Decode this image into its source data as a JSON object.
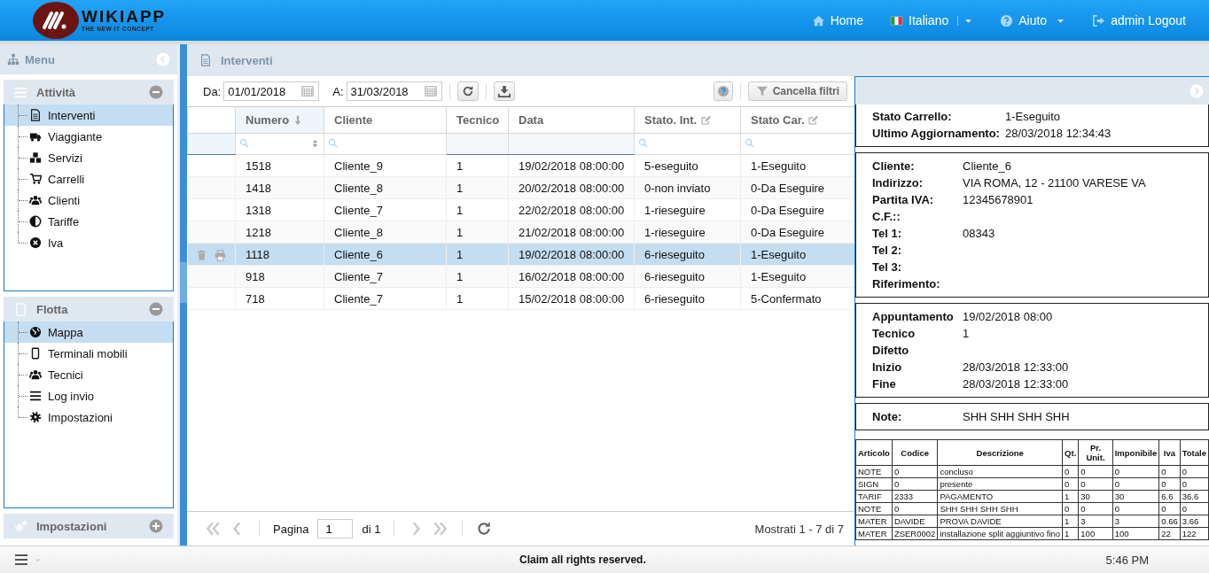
{
  "header": {
    "logo": {
      "name": "WIKIAPP",
      "tagline": "THE NEW IT CONCEPT"
    },
    "nav": [
      {
        "kind": "home",
        "label": "Home",
        "dropdown": false
      },
      {
        "kind": "language",
        "label": "Italiano",
        "dropdown": true
      },
      {
        "kind": "help",
        "label": "Aiuto",
        "dropdown": true
      },
      {
        "kind": "logout",
        "label": "admin Logout",
        "dropdown": false
      }
    ]
  },
  "sidebar": {
    "title": "Menu",
    "sections": [
      {
        "kind": "list",
        "title": "Attività",
        "expanded": true,
        "items": [
          {
            "kind": "document",
            "label": "Interventi",
            "selected": true
          },
          {
            "kind": "truck",
            "label": "Viaggiante",
            "selected": false
          },
          {
            "kind": "cubes",
            "label": "Servizi",
            "selected": false
          },
          {
            "kind": "cart",
            "label": "Carrelli",
            "selected": false
          },
          {
            "kind": "users",
            "label": "Clienti",
            "selected": false
          },
          {
            "kind": "half",
            "label": "Tariffe",
            "selected": false
          },
          {
            "kind": "xcircle",
            "label": "Iva",
            "selected": false
          }
        ]
      },
      {
        "kind": "tablet",
        "title": "Flotta",
        "expanded": true,
        "items": [
          {
            "kind": "globe",
            "label": "Mappa",
            "selected": true
          },
          {
            "kind": "mobile",
            "label": "Terminali mobili",
            "selected": false
          },
          {
            "kind": "users",
            "label": "Tecnici",
            "selected": false
          },
          {
            "kind": "list",
            "label": "Log invio",
            "selected": false
          },
          {
            "kind": "gear",
            "label": "Impostazioni",
            "selected": false
          }
        ]
      },
      {
        "kind": "gears",
        "title": "Impostazioni",
        "expanded": false
      }
    ]
  },
  "main": {
    "title": "Interventi",
    "toolbar": {
      "from": {
        "label": "Da:",
        "value": "01/01/2018"
      },
      "to": {
        "label": "A:",
        "value": "31/03/2018"
      },
      "clear_filters": "Cancella filtri"
    },
    "grid": {
      "columns": [
        {
          "label": "Numero",
          "sorted": true,
          "editable": false,
          "kind": "numeric"
        },
        {
          "label": "Cliente",
          "sorted": false,
          "editable": false,
          "kind": "search"
        },
        {
          "label": "Tecnico",
          "sorted": false,
          "editable": false,
          "kind": "none"
        },
        {
          "label": "Data",
          "sorted": false,
          "editable": false,
          "kind": "none"
        },
        {
          "label": "Stato. Int.",
          "sorted": false,
          "editable": true,
          "kind": "search"
        },
        {
          "label": "Stato Car.",
          "sorted": false,
          "editable": true,
          "kind": "search"
        }
      ],
      "rows": [
        {
          "cells": [
            "1518",
            "Cliente_9",
            "1",
            "19/02/2018 08:00:00",
            "5-eseguito",
            "1-Eseguito"
          ],
          "selected": false
        },
        {
          "cells": [
            "1418",
            "Cliente_8",
            "1",
            "20/02/2018 08:00:00",
            "0-non inviato",
            "0-Da Eseguire"
          ],
          "selected": false
        },
        {
          "cells": [
            "1318",
            "Cliente_7",
            "1",
            "22/02/2018 08:00:00",
            "1-rieseguire",
            "0-Da Eseguire"
          ],
          "selected": false
        },
        {
          "cells": [
            "1218",
            "Cliente_8",
            "1",
            "21/02/2018 08:00:00",
            "1-rieseguire",
            "0-Da Eseguire"
          ],
          "selected": false
        },
        {
          "cells": [
            "1118",
            "Cliente_6",
            "1",
            "19/02/2018 08:00:00",
            "6-rieseguito",
            "1-Eseguito"
          ],
          "selected": true
        },
        {
          "cells": [
            "918",
            "Cliente_7",
            "1",
            "16/02/2018 08:00:00",
            "6-rieseguito",
            "1-Eseguito"
          ],
          "selected": false
        },
        {
          "cells": [
            "718",
            "Cliente_7",
            "1",
            "15/02/2018 08:00:00",
            "6-rieseguito",
            "5-Confermato"
          ],
          "selected": false
        }
      ]
    },
    "pager": {
      "page_label": "Pagina",
      "page": "1",
      "of": "di 1",
      "summary": "Mostrati 1 - 7 di 7"
    }
  },
  "detail": {
    "sections": [
      {
        "fields": [
          {
            "label": "Stato Carrello:",
            "value": "1-Eseguito"
          },
          {
            "label": "Ultimo Aggiornamento:",
            "value": "28/03/2018 12:34:43"
          }
        ]
      },
      {
        "fields": [
          {
            "label": "Cliente:",
            "value": "Cliente_6"
          },
          {
            "label": "Indirizzo:",
            "value": "VIA ROMA, 12 - 21100 VARESE VA"
          },
          {
            "label": "Partita IVA:",
            "value": "12345678901"
          },
          {
            "label": "C.F.::"
          },
          {
            "label": "Tel 1:",
            "value": "08343"
          },
          {
            "label": "Tel 2:"
          },
          {
            "label": "Tel 3:"
          },
          {
            "label": "Riferimento:"
          }
        ]
      },
      {
        "fields": [
          {
            "label": "Appuntamento",
            "value": "19/02/2018 08:00"
          },
          {
            "label": "Tecnico",
            "value": "1"
          },
          {
            "label": "Difetto"
          },
          {
            "label": "Inizio",
            "value": "28/03/2018 12:33:00"
          },
          {
            "label": "Fine",
            "value": "28/03/2018 12:33:00"
          }
        ]
      },
      {
        "fields": [
          {
            "label": "Note:",
            "value": "SHH SHH SHH SHH"
          }
        ]
      }
    ],
    "items_table": {
      "columns": [
        "Articolo",
        "Codice",
        "Descrizione",
        "Qt.",
        "Pr. Unit.",
        "Imponibile",
        "Iva",
        "Totale"
      ],
      "rows": [
        [
          "NOTE",
          "0",
          "concluso",
          "0",
          "0",
          "0",
          "0",
          "0"
        ],
        [
          "SIGN",
          "0",
          "presente",
          "0",
          "0",
          "0",
          "0",
          "0"
        ],
        [
          "TARIF",
          "2333",
          "PAGAMENTO",
          "1",
          "30",
          "30",
          "6.6",
          "36.6"
        ],
        [
          "NOTE",
          "0",
          "SHH SHH SHH SHH",
          "0",
          "0",
          "0",
          "0",
          "0"
        ],
        [
          "MATER",
          "DAVIDE",
          "PROVA DAVIDE",
          "1",
          "3",
          "3",
          "0.66",
          "3.66"
        ],
        [
          "MATER",
          "ZSER0002",
          "installazione split aggiuntivo fino",
          "1",
          "100",
          "100",
          "22",
          "122"
        ]
      ]
    }
  },
  "footer": {
    "text": "Claim all rights reserved.",
    "time": "5:46 PM"
  }
}
